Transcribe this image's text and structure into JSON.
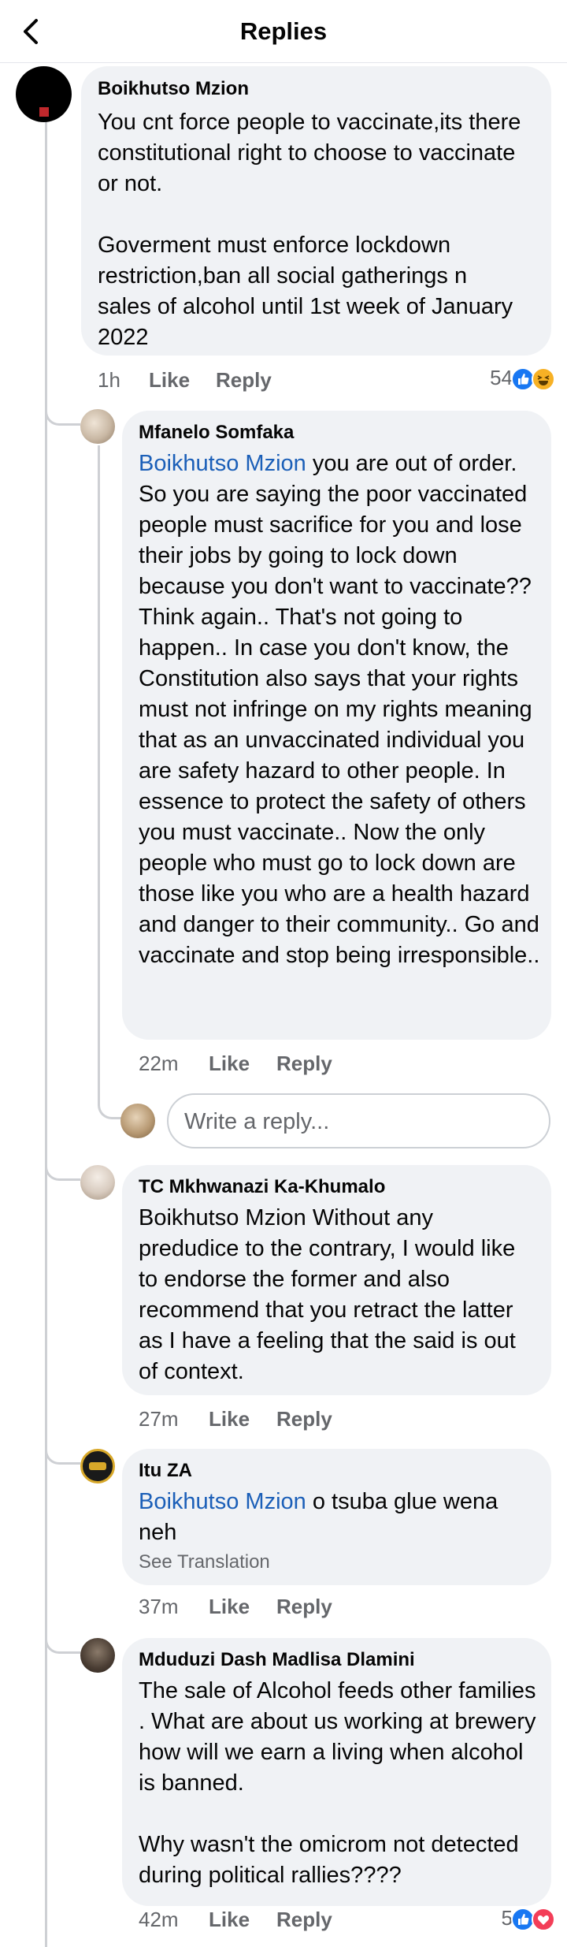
{
  "header": {
    "title": "Replies",
    "back_icon": "chevron-left-icon"
  },
  "parent_comment": {
    "author": "Boikhutso Mzion",
    "text": "You cnt force people to vaccinate,its there constitutional right to choose to vaccinate or not.\n\nGoverment must enforce lockdown restriction,ban all social gatherings n sales of alcohol until 1st week of January 2022",
    "time": "1h",
    "like_label": "Like",
    "reply_label": "Reply",
    "reaction_count": "54",
    "reaction_icons": [
      "like-icon",
      "haha-icon"
    ]
  },
  "replies": [
    {
      "author": "Mfanelo Somfaka",
      "mention": "Boikhutso Mzion",
      "text": " you are out of order. So you are saying the poor vaccinated people must sacrifice for you and lose their jobs by going to lock down because you don't want to vaccinate?? Think again.. That's not going to happen.. In case you don't know, the Constitution also says that your rights must not infringe on my rights meaning that as an unvaccinated individual you are safety hazard to other people. In essence to protect the safety of others you must vaccinate.. Now the only people who must go to lock down are those like you who are a health hazard and danger to their community.. Go and vaccinate and stop being irresponsible..",
      "time": "22m",
      "like_label": "Like",
      "reply_label": "Reply"
    },
    {
      "author": "TC Mkhwanazi Ka-Khumalo",
      "text": "Boikhutso Mzion Without any predudice to the contrary, I would like to endorse the former and also recommend that you retract the latter as I have a feeling that the said is out of context.",
      "time": "27m",
      "like_label": "Like",
      "reply_label": "Reply"
    },
    {
      "author": "Itu ZA",
      "mention": "Boikhutso Mzion",
      "text": " o tsuba glue wena neh",
      "see_translation": "See Translation",
      "time": "37m",
      "like_label": "Like",
      "reply_label": "Reply"
    },
    {
      "author": "Mduduzi Dash Madlisa Dlamini",
      "text": "The sale of Alcohol feeds other families . What are about us working at brewery how will we earn a living when alcohol is banned.\n\nWhy wasn't the omicrom not detected during political rallies????",
      "time": "42m",
      "like_label": "Like",
      "reply_label": "Reply",
      "reaction_count": "5",
      "reaction_icons": [
        "like-icon",
        "love-icon"
      ]
    }
  ],
  "write_reply": {
    "placeholder": "Write a reply..."
  },
  "colors": {
    "mention": "#1b5fb8",
    "bubble": "#f0f2f5",
    "meta": "#65676b",
    "like_blue": "#1877f2",
    "love_red": "#f33e58",
    "haha_yellow": "#f7b125"
  }
}
